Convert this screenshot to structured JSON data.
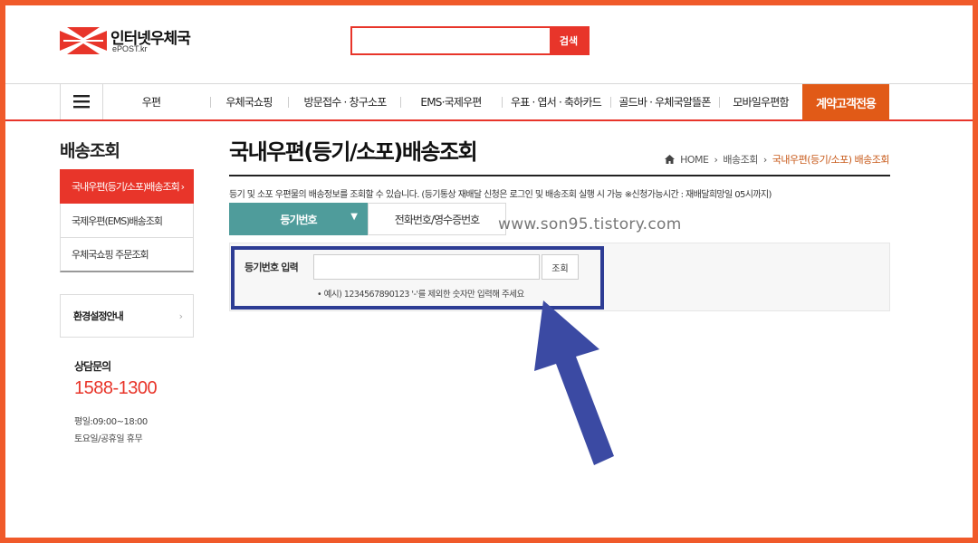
{
  "header": {
    "brand_name": "인터넷우체국",
    "brand_sub": "ePOST.kr",
    "search_placeholder": "",
    "search_button": "검색"
  },
  "nav": {
    "menu_icon": "hamburger-icon",
    "items": [
      "우편",
      "우체국쇼핑",
      "방문접수 · 창구소포",
      "EMS·국제우편",
      "우표 · 엽서 · 축하카드",
      "골드바 · 우체국알뜰폰",
      "모바일우편함"
    ],
    "special": "계약고객전용"
  },
  "sidebar": {
    "title": "배송조회",
    "items": [
      {
        "label": "국내우편(등기/소포)배송조회",
        "active": true
      },
      {
        "label": "국제우편(EMS)배송조회",
        "active": false
      },
      {
        "label": "우체국쇼핑 주문조회",
        "active": false
      }
    ],
    "env_label": "환경설정안내",
    "contact_title": "상담문의",
    "contact_phone": "1588-1300",
    "hours_weekday": "평일:09:00~18:00",
    "hours_weekend": "토요일/공휴일 휴무"
  },
  "main": {
    "page_title": "국내우편(등기/소포)배송조회",
    "breadcrumb": [
      "HOME",
      "배송조회",
      "국내우편(등기/소포) 배송조회"
    ],
    "description": "등기 및 소포 우편물의 배송정보를 조회할 수 있습니다. (등기통상 재배달 신청은 로그인 및 배송조회 실행 시 가능 ※신청가능시간 : 재배달희망일 05시까지)",
    "tab_active": "등기번호",
    "tab_inactive": "전화번호/영수증번호",
    "watermark": "www.son95.tistory.com",
    "form_label": "등기번호 입력",
    "form_input_value": "",
    "form_button": "조회",
    "form_hint": "• 예시) 1234567890123 '-'를 제외한 숫자만 입력해 주세요"
  },
  "colors": {
    "brand_red": "#e8352a",
    "frame_orange": "#f05a2a",
    "nav_special": "#e15a17",
    "tab_teal": "#4f9c9b",
    "annotation_blue": "#2d3c94"
  }
}
